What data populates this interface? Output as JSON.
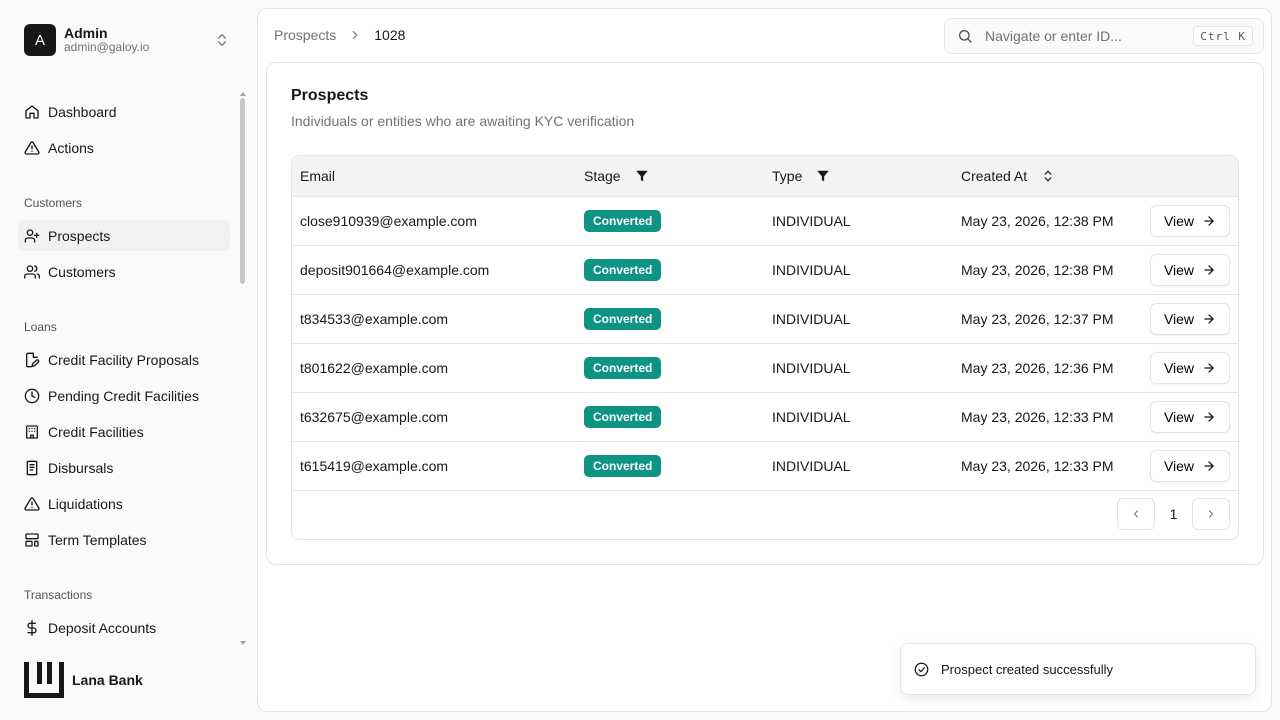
{
  "user": {
    "initial": "A",
    "name": "Admin",
    "email": "admin@galoy.io"
  },
  "nav": {
    "top": [
      {
        "label": "Dashboard",
        "icon": "home-icon"
      },
      {
        "label": "Actions",
        "icon": "alert-triangle-icon"
      }
    ],
    "sections": [
      {
        "title": "Customers",
        "items": [
          {
            "label": "Prospects",
            "icon": "user-plus-icon",
            "active": true
          },
          {
            "label": "Customers",
            "icon": "users-icon"
          }
        ]
      },
      {
        "title": "Loans",
        "items": [
          {
            "label": "Credit Facility Proposals",
            "icon": "file-edit-icon"
          },
          {
            "label": "Pending Credit Facilities",
            "icon": "clock-icon"
          },
          {
            "label": "Credit Facilities",
            "icon": "bank-icon"
          },
          {
            "label": "Disbursals",
            "icon": "receipt-icon"
          },
          {
            "label": "Liquidations",
            "icon": "alert-triangle-icon"
          },
          {
            "label": "Term Templates",
            "icon": "layout-template-icon"
          }
        ]
      },
      {
        "title": "Transactions",
        "items": [
          {
            "label": "Deposit Accounts",
            "icon": "dollar-icon"
          }
        ]
      }
    ]
  },
  "brand": {
    "name": "Lana Bank"
  },
  "breadcrumb": {
    "parent": "Prospects",
    "current": "1028"
  },
  "search": {
    "placeholder": "Navigate or enter ID...",
    "shortcut": "Ctrl K"
  },
  "card": {
    "title": "Prospects",
    "subtitle": "Individuals or entities who are awaiting KYC verification"
  },
  "table": {
    "headers": {
      "email": "Email",
      "stage": "Stage",
      "type": "Type",
      "created": "Created At"
    },
    "view_label": "View",
    "rows": [
      {
        "email": "close910939@example.com",
        "stage": "Converted",
        "type": "INDIVIDUAL",
        "created": "May 23, 2026, 12:38 PM"
      },
      {
        "email": "deposit901664@example.com",
        "stage": "Converted",
        "type": "INDIVIDUAL",
        "created": "May 23, 2026, 12:38 PM"
      },
      {
        "email": "t834533@example.com",
        "stage": "Converted",
        "type": "INDIVIDUAL",
        "created": "May 23, 2026, 12:37 PM"
      },
      {
        "email": "t801622@example.com",
        "stage": "Converted",
        "type": "INDIVIDUAL",
        "created": "May 23, 2026, 12:36 PM"
      },
      {
        "email": "t632675@example.com",
        "stage": "Converted",
        "type": "INDIVIDUAL",
        "created": "May 23, 2026, 12:33 PM"
      },
      {
        "email": "t615419@example.com",
        "stage": "Converted",
        "type": "INDIVIDUAL",
        "created": "May 23, 2026, 12:33 PM"
      }
    ]
  },
  "pagination": {
    "page": "1"
  },
  "toast": {
    "message": "Prospect created successfully"
  },
  "colors": {
    "badge": "#0e9485",
    "text": "#18181b",
    "muted": "#71717a",
    "border": "#e4e4e7"
  }
}
